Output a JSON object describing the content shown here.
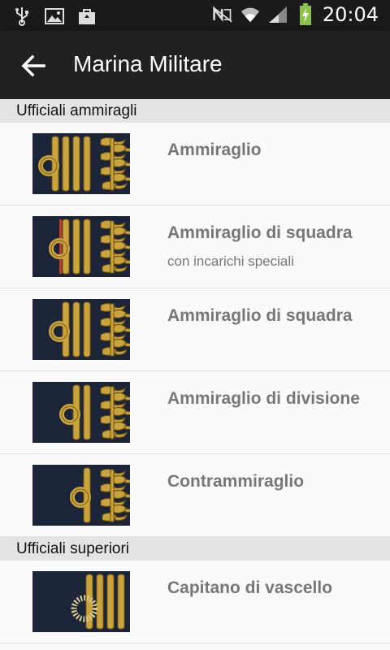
{
  "status_bar": {
    "time": "20:04",
    "left_icons": [
      "usb-icon",
      "image-icon",
      "bag-icon"
    ],
    "right_icons": [
      "nfc-off-icon",
      "wifi-icon",
      "signal-icon",
      "battery-charging-icon"
    ]
  },
  "app_bar": {
    "title": "Marina Militare",
    "back_icon": "arrow-back-icon"
  },
  "colors": {
    "navy": "#1c2538",
    "gold": "#c9a43d",
    "red": "#c0392b",
    "header": "#212121",
    "section_bg": "#e4e4e4"
  },
  "sections": [
    {
      "header": "Ufficiali ammiragli",
      "items": [
        {
          "title": "Ammiraglio",
          "subtitle": "",
          "stripes": 4,
          "loop": "ring",
          "red_stripe": false
        },
        {
          "title": "Ammiraglio di squadra",
          "subtitle": "con incarichi speciali",
          "stripes": 3,
          "loop": "ring",
          "red_stripe": true
        },
        {
          "title": "Ammiraglio di squadra",
          "subtitle": "",
          "stripes": 3,
          "loop": "ring",
          "red_stripe": false
        },
        {
          "title": "Ammiraglio di divisione",
          "subtitle": "",
          "stripes": 2,
          "loop": "ring",
          "red_stripe": false
        },
        {
          "title": "Contrammiraglio",
          "subtitle": "",
          "stripes": 1,
          "loop": "ring",
          "red_stripe": false
        }
      ]
    },
    {
      "header": "Ufficiali superiori",
      "items": [
        {
          "title": "Capitano di vascello",
          "subtitle": "",
          "stripes": 4,
          "loop": "rope",
          "red_stripe": false
        }
      ]
    }
  ]
}
